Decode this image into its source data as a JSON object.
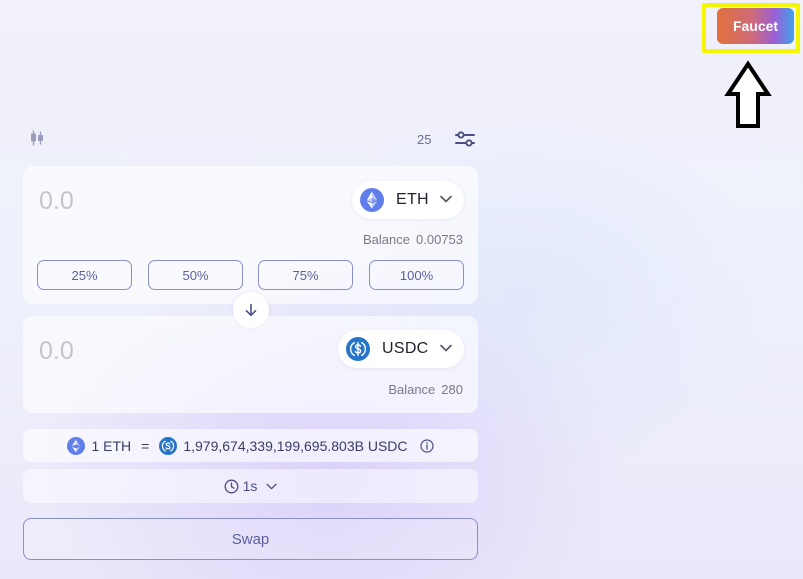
{
  "header": {
    "faucet_label": "Faucet"
  },
  "toolbar": {
    "chart_icon": "candlestick-chart-icon",
    "slippage_value": "25",
    "settings_icon": "sliders-icon"
  },
  "from": {
    "amount_placeholder": "0.0",
    "token_symbol": "ETH",
    "token_icon": "eth-icon",
    "balance_label": "Balance",
    "balance_value": "0.00753",
    "percent_buttons": [
      "25%",
      "50%",
      "75%",
      "100%"
    ]
  },
  "switch": {
    "icon": "arrow-down-icon"
  },
  "to": {
    "amount_placeholder": "0.0",
    "token_symbol": "USDC",
    "token_icon": "usdc-icon",
    "balance_label": "Balance",
    "balance_value": "280"
  },
  "rate": {
    "from_amount": "1 ETH",
    "equals": "=",
    "to_amount": "1,979,674,339,199,695.803B USDC",
    "info_icon": "info-icon"
  },
  "refresh": {
    "icon": "clock-icon",
    "interval": "1s"
  },
  "swap": {
    "label": "Swap"
  },
  "colors": {
    "accent": "#5a609e",
    "eth": "#627eea",
    "usdc": "#2775ca",
    "highlight": "#f5f500"
  }
}
